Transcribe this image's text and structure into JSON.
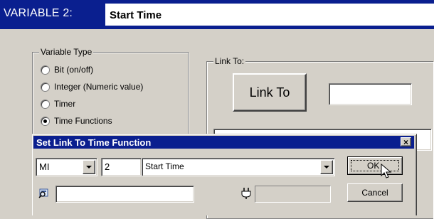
{
  "header": {
    "variable_label": "VARIABLE 2:",
    "variable_name": "Start Time"
  },
  "variable_type": {
    "legend": "Variable Type",
    "options": [
      {
        "label": "Bit (on/off)",
        "selected": false
      },
      {
        "label": "Integer (Numeric value)",
        "selected": false
      },
      {
        "label": "Timer",
        "selected": false
      },
      {
        "label": "Time Functions",
        "selected": true
      }
    ]
  },
  "link_group": {
    "legend": "Link To:",
    "button_label": "Link To",
    "value": ""
  },
  "dialog": {
    "title": "Set Link To Time Function",
    "close_glyph": "×",
    "type_value": "MI",
    "number_value": "2",
    "function_value": "Start Time",
    "ok_label": "OK",
    "cancel_label": "Cancel",
    "text_field_value": "",
    "readonly_field_value": ""
  }
}
